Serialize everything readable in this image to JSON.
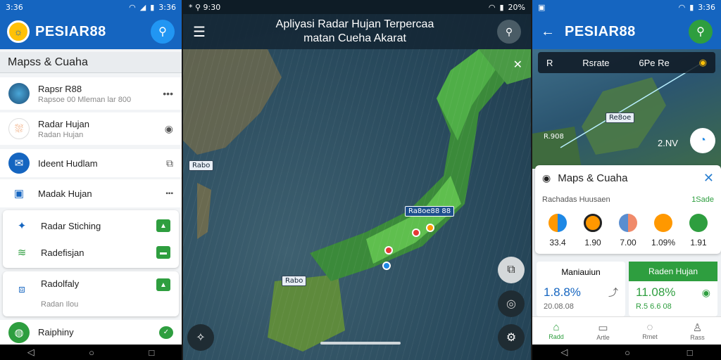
{
  "left": {
    "status": {
      "time": "3:36",
      "right": "3:36"
    },
    "brand": "PESIAR88",
    "section_title": "Mapss & Cuaha",
    "rows": [
      {
        "title": "Rapsr R88",
        "subtitle": "Rapsoe 00 Mleman lar 800",
        "trail": "•••"
      },
      {
        "title": "Radar Hujan",
        "subtitle": "Radan Hujan",
        "trail": "◉"
      },
      {
        "title": "Ideent Hudlam",
        "subtitle": "",
        "trail": "⧉"
      },
      {
        "title": "Madak Hujan",
        "subtitle": "",
        "trail": "▪▪▪"
      },
      {
        "title": "Radar Stiching",
        "subtitle": "",
        "trail": "▲"
      },
      {
        "title": "Radefisjan",
        "subtitle": "",
        "trail": "▬"
      },
      {
        "title": "Radolfaly",
        "subtitle": "Radan Ilou",
        "trail": "▲"
      },
      {
        "title": "Raiphiny",
        "subtitle": "",
        "trail": "✓"
      }
    ]
  },
  "mid": {
    "status": {
      "left": "* ⚲ 9:30",
      "right": "20%"
    },
    "title_line1": "Apliyasi Radar Hujan Terpercaa",
    "title_line2": "matan Cueha Akarat",
    "labels": [
      "Ra8oe88 88",
      "Rabo",
      "Rabo"
    ]
  },
  "right": {
    "status": {
      "right": "3:36"
    },
    "brand": "PESIAR88",
    "info": {
      "left": "R",
      "mid": "Rsrate",
      "right": "6Pe Re"
    },
    "map_labels": [
      "Re8oe",
      "R.908",
      "2.NV"
    ],
    "sheet": {
      "title": "Maps & Cuaha",
      "subtitle": "Rachadas Huusaen",
      "subtitle_right": "1Sade",
      "forecast": [
        "33.4",
        "1.90",
        "7.00",
        "1.09%",
        "1.91"
      ]
    },
    "stat_left": {
      "header": "Maniauiun",
      "value": "1.8.8%",
      "small": "20.08.08"
    },
    "stat_right": {
      "header": "Raden Hujan",
      "value": "11.08%",
      "small": "R.5 6.6 08"
    },
    "tabs": [
      "Radd",
      "Artle",
      "Rmet",
      "Rass"
    ]
  }
}
